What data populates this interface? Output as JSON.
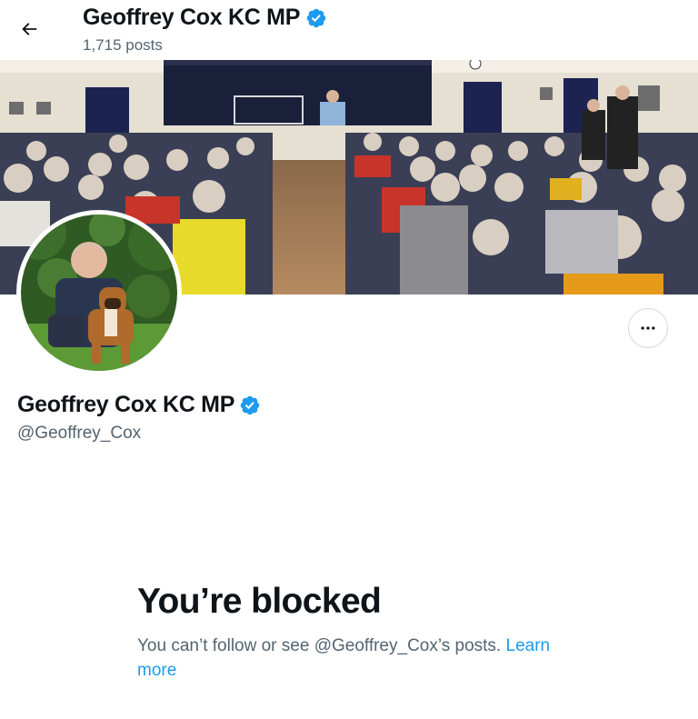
{
  "header": {
    "back_icon": "arrow-left-icon",
    "name": "Geoffrey Cox KC MP",
    "post_count": "1,715 posts",
    "verified_icon": "verified-badge-icon"
  },
  "profile": {
    "name": "Geoffrey Cox KC MP",
    "handle": "@Geoffrey_Cox",
    "more_icon": "more-options-icon"
  },
  "blocked": {
    "title": "You’re blocked",
    "message": "You can’t follow or see @Geoffrey_Cox’s posts.",
    "link": "Learn more"
  },
  "colors": {
    "accent": "#1d9bf0",
    "text_primary": "#0f1419",
    "text_secondary": "#536471",
    "border": "#cfd9de"
  }
}
